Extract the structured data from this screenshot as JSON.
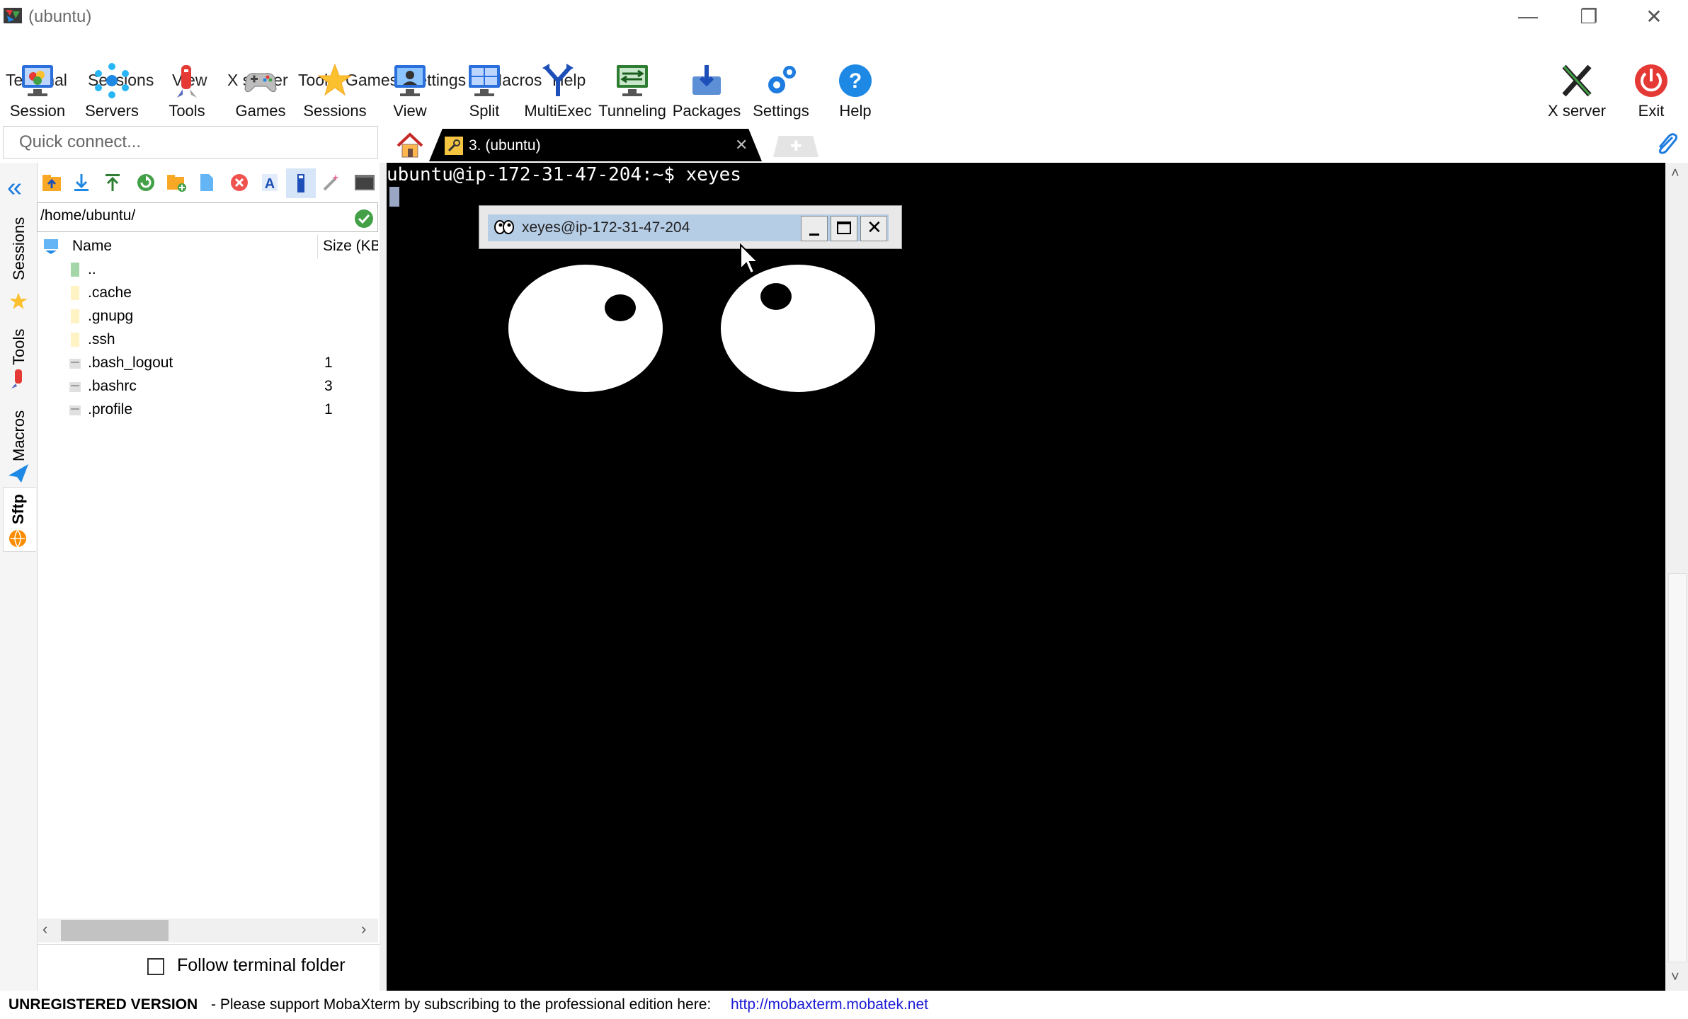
{
  "window": {
    "title": "(ubuntu)"
  },
  "menu": [
    "Terminal",
    "Sessions",
    "View",
    "X server",
    "Tools",
    "Games",
    "Settings",
    "Macros",
    "Help"
  ],
  "toolbar": [
    {
      "label": "Session",
      "icon": "session-icon"
    },
    {
      "label": "Servers",
      "icon": "servers-icon"
    },
    {
      "label": "Tools",
      "icon": "tools-icon"
    },
    {
      "label": "Games",
      "icon": "games-icon"
    },
    {
      "label": "Sessions",
      "icon": "star-icon"
    },
    {
      "label": "View",
      "icon": "view-icon"
    },
    {
      "label": "Split",
      "icon": "split-icon"
    },
    {
      "label": "MultiExec",
      "icon": "multiexec-icon"
    },
    {
      "label": "Tunneling",
      "icon": "tunneling-icon"
    },
    {
      "label": "Packages",
      "icon": "packages-icon"
    },
    {
      "label": "Settings",
      "icon": "gears-icon"
    },
    {
      "label": "Help",
      "icon": "help-icon"
    }
  ],
  "toolbar_right": [
    {
      "label": "X server",
      "icon": "x-server-icon"
    },
    {
      "label": "Exit",
      "icon": "power-icon"
    }
  ],
  "quick_connect": {
    "placeholder": "Quick connect..."
  },
  "tabs": {
    "active_label": "3. (ubuntu)"
  },
  "side_tabs": [
    "Sessions",
    "Tools",
    "Macros",
    "Sftp"
  ],
  "sftp": {
    "path": "/home/ubuntu/",
    "columns": {
      "name": "Name",
      "size": "Size (KB)"
    },
    "files": [
      {
        "name": "..",
        "size": ""
      },
      {
        "name": ".cache",
        "size": ""
      },
      {
        "name": ".gnupg",
        "size": ""
      },
      {
        "name": ".ssh",
        "size": ""
      },
      {
        "name": ".bash_logout",
        "size": "1"
      },
      {
        "name": ".bashrc",
        "size": "3"
      },
      {
        "name": ".profile",
        "size": "1"
      }
    ],
    "follow_label": "Follow terminal folder"
  },
  "terminal": {
    "prompt": "ubuntu@ip-172-31-47-204:~$ xeyes"
  },
  "xeyes": {
    "title": "xeyes@ip-172-31-47-204"
  },
  "status": {
    "unregistered": "UNREGISTERED VERSION",
    "support": "-  Please support MobaXterm by subscribing to the professional edition here:",
    "link": "http://mobaxterm.mobatek.net"
  },
  "colors": {
    "accent": "#1e7be0",
    "terminal_bg": "#000000",
    "xeyes_titlebar": "#b6cde6"
  }
}
